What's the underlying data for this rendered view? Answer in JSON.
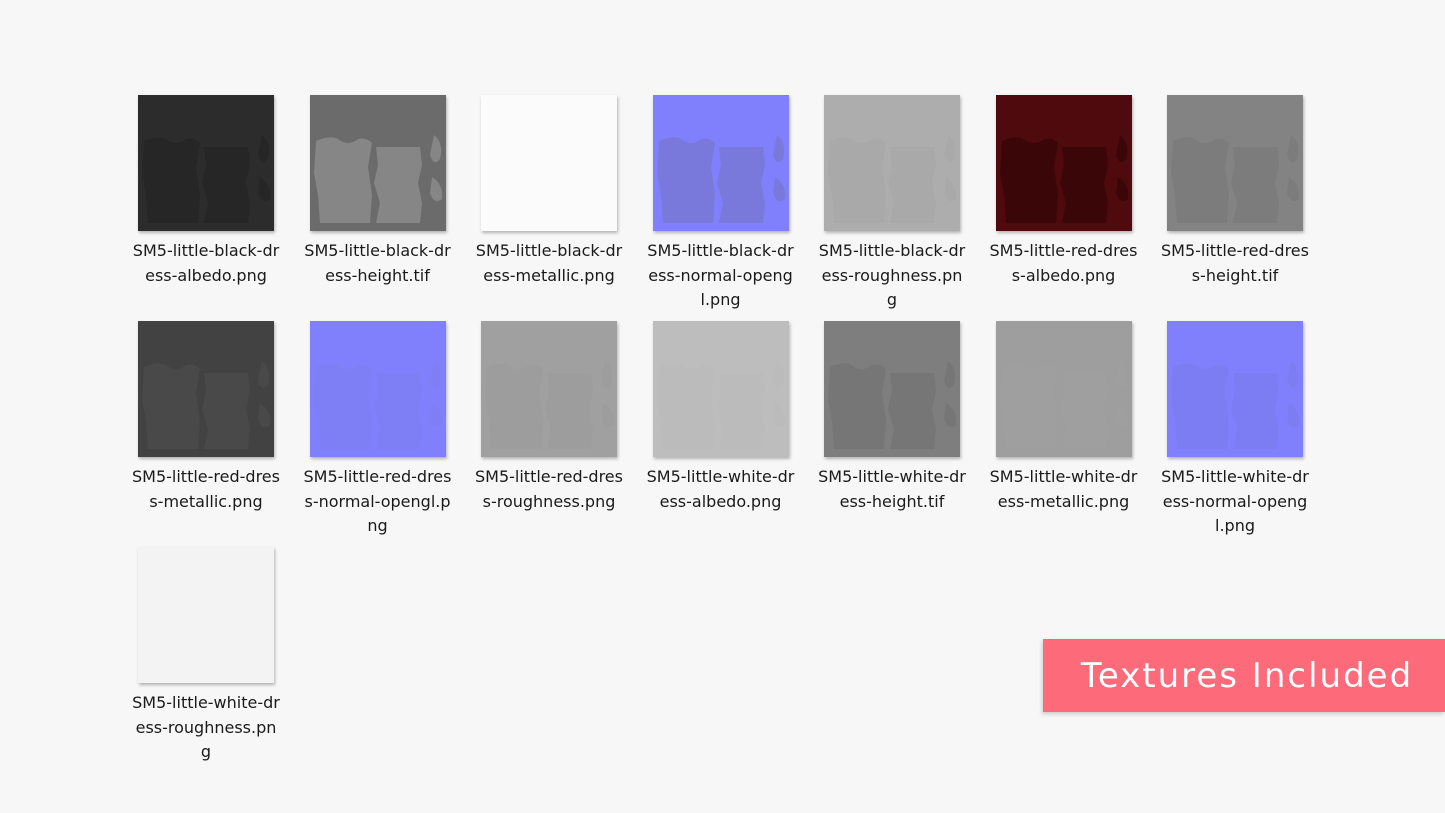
{
  "files": [
    {
      "name": "SM5-little-black-dress-albedo.png",
      "color": "#2c2c2c",
      "shape": "#262626"
    },
    {
      "name": "SM5-little-black-dress-height.tif",
      "color": "#6b6b6b",
      "shape": "#8a8a8a"
    },
    {
      "name": "SM5-little-black-dress-metallic.png",
      "color": "#fbfbfb",
      "shape": "#fbfbfb"
    },
    {
      "name": "SM5-little-black-dress-normal-opengl.png",
      "color": "#8080fc",
      "shape": "#7878d8"
    },
    {
      "name": "SM5-little-black-dress-roughness.png",
      "color": "#adadad",
      "shape": "#a8a8a8"
    },
    {
      "name": "SM5-little-red-dress-albedo.png",
      "color": "#4e0a0c",
      "shape": "#3a0608"
    },
    {
      "name": "SM5-little-red-dress-height.tif",
      "color": "#838383",
      "shape": "#7b7b7b"
    },
    {
      "name": "SM5-little-red-dress-metallic.png",
      "color": "#424242",
      "shape": "#4a4a4a"
    },
    {
      "name": "SM5-little-red-dress-normal-opengl.png",
      "color": "#8080fc",
      "shape": "#7e7ef4"
    },
    {
      "name": "SM5-little-red-dress-roughness.png",
      "color": "#a0a0a0",
      "shape": "#9c9c9c"
    },
    {
      "name": "SM5-little-white-dress-albedo.png",
      "color": "#bdbdbd",
      "shape": "#bababa"
    },
    {
      "name": "SM5-little-white-dress-height.tif",
      "color": "#7e7e7e",
      "shape": "#767676"
    },
    {
      "name": "SM5-little-white-dress-metallic.png",
      "color": "#9e9e9e",
      "shape": "#9e9e9e"
    },
    {
      "name": "SM5-little-white-dress-normal-opengl.png",
      "color": "#8080fc",
      "shape": "#7c7cf2"
    },
    {
      "name": "SM5-little-white-dress-roughness.png",
      "color": "#f3f3f3",
      "shape": "#f3f3f3"
    }
  ],
  "badge": {
    "label": "Textures Included",
    "color": "#fd6a7a"
  }
}
